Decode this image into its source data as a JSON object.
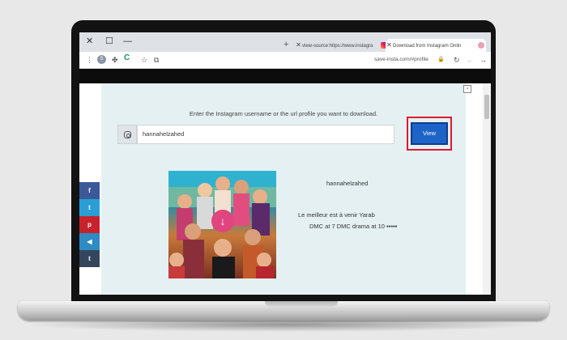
{
  "browser": {
    "tabs": [
      {
        "label": "view-source:https://www.instagra"
      },
      {
        "label": "Download from Instagram Onlin"
      }
    ],
    "new_tab_symbol": "+",
    "window_controls": {
      "close": "✕",
      "maximize": "☐",
      "minimize": "—"
    },
    "address": "save-insta.com/#profile",
    "profile_initial": "S",
    "icons": [
      "menu-dots-icon",
      "profile-icon",
      "extension-icon",
      "c-extension-icon",
      "star-icon",
      "puzzle-icon",
      "lock-icon",
      "reload-icon",
      "back-icon",
      "forward-icon"
    ]
  },
  "page": {
    "prompt": "Enter the Instagram username or the url profile you want to download.",
    "search_value": "hannahelzahed",
    "view_label": "View",
    "username": "hannahelzahed",
    "bio_line1": "Le meilleur est à venir Yarab",
    "bio_line2": "DMC at 7 DMC drama at 10 ▪▪▪▪▪"
  },
  "share": [
    {
      "name": "facebook",
      "glyph": "f"
    },
    {
      "name": "twitter",
      "glyph": "t"
    },
    {
      "name": "pinterest",
      "glyph": "p"
    },
    {
      "name": "telegram",
      "glyph": "◀"
    },
    {
      "name": "tumblr",
      "glyph": "t"
    }
  ],
  "colors": {
    "view_button": "#1e63c8",
    "highlight": "#e0192f",
    "panel": "#e4f0f2"
  }
}
